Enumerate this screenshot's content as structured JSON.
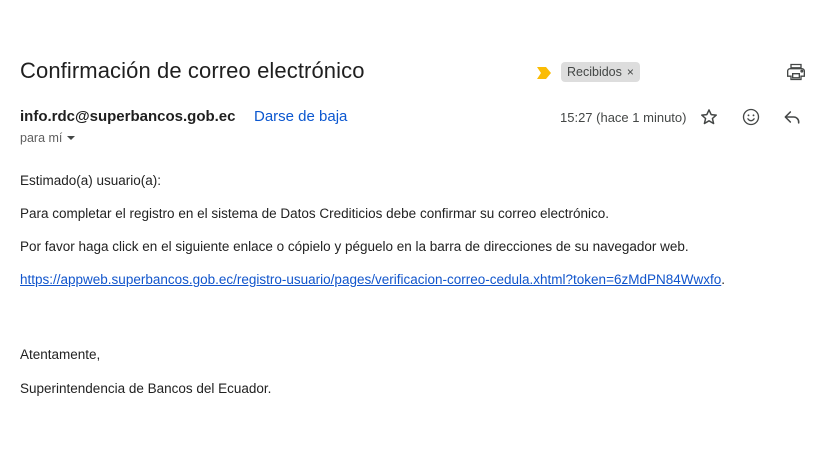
{
  "email": {
    "subject": "Confirmación de correo electrónico",
    "label": "Recibidos",
    "label_remove": "×",
    "sender": "info.rdc@superbancos.gob.ec",
    "unsubscribe": "Darse de baja",
    "timestamp": "15:27 (hace 1 minuto)",
    "recipient": "para mí"
  },
  "body": {
    "greeting": "Estimado(a) usuario(a):",
    "paragraph1": "Para completar el registro en el sistema de Datos Crediticios debe confirmar su correo electrónico.",
    "paragraph2": "Por favor haga click en el siguiente enlace o cópielo y péguelo en la barra de direcciones de su navegador web.",
    "link": "https://appweb.superbancos.gob.ec/registro-usuario/pages/verificacion-correo-cedula.xhtml?token=6zMdPN84Wwxfo",
    "link_suffix": ".",
    "closing": "Atentamente,",
    "signature": "Superintendencia de Bancos del Ecuador."
  },
  "icons": {
    "importance": "importance-marker-icon",
    "print": "print-icon",
    "star": "star-icon",
    "emoji": "emoji-reaction-icon",
    "reply": "reply-icon",
    "dropdown": "chevron-down-icon"
  },
  "colors": {
    "link": "#1155cc",
    "unsubscribe": "#0b57d0",
    "importance": "#fbbc04",
    "chip_bg": "#dddddd"
  }
}
